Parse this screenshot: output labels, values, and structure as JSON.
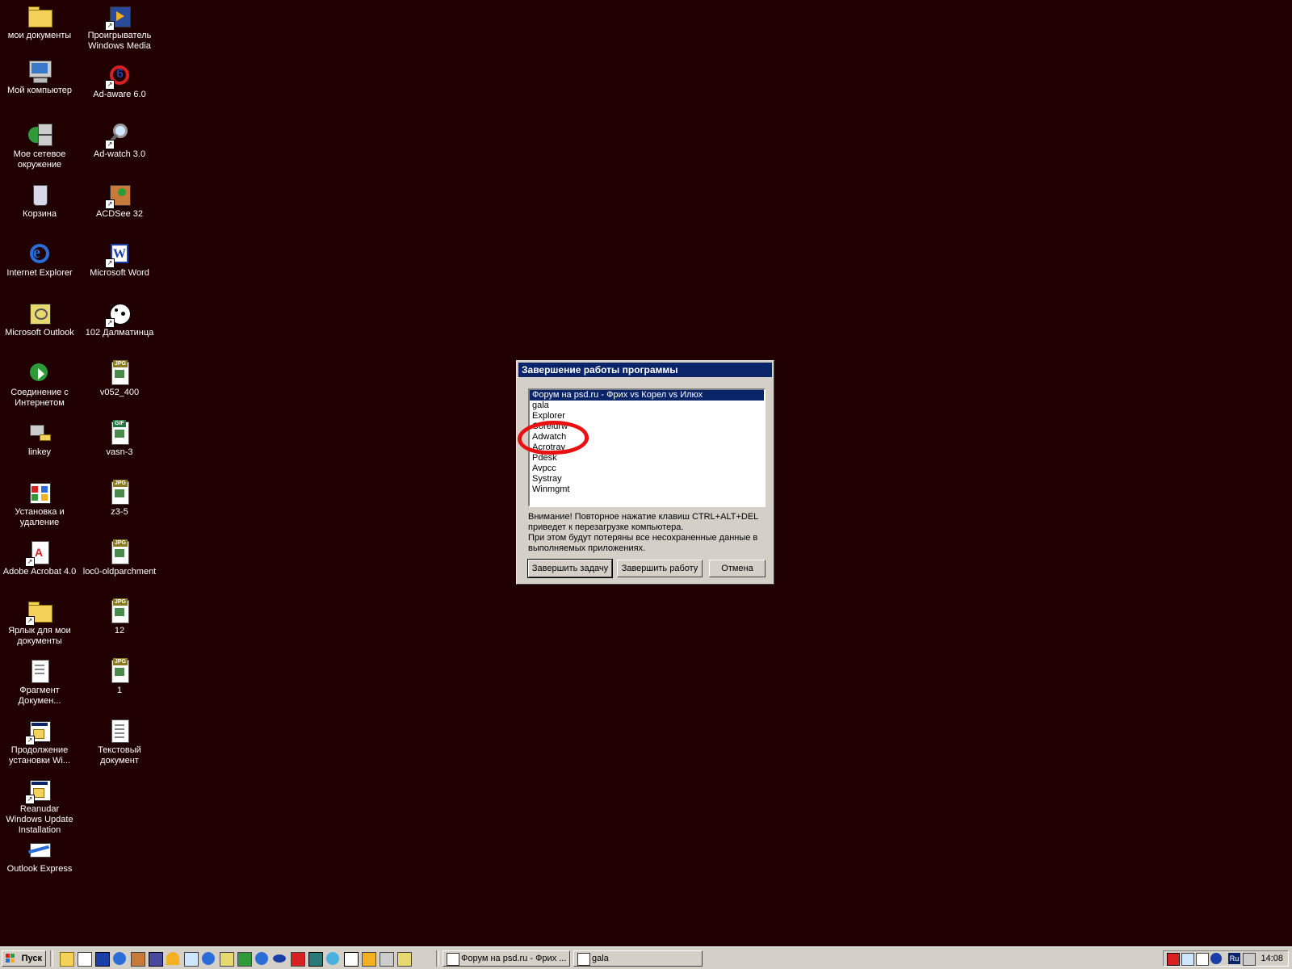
{
  "desktop": {
    "background": "#200000",
    "icons": [
      {
        "label": "мои документы",
        "icon": "folder-icon"
      },
      {
        "label": "Проигрыватель Windows Media",
        "icon": "media-player-icon"
      },
      {
        "label": "Мой компьютер",
        "icon": "computer-icon"
      },
      {
        "label": "Ad-aware 6.0",
        "icon": "adaware-icon"
      },
      {
        "label": "Мое сетевое окружение",
        "icon": "network-icon"
      },
      {
        "label": "Ad-watch 3.0",
        "icon": "adwatch-icon"
      },
      {
        "label": "Корзина",
        "icon": "recycle-bin-icon"
      },
      {
        "label": "ACDSee 32",
        "icon": "acdsee-icon"
      },
      {
        "label": "Internet Explorer",
        "icon": "internet-explorer-icon"
      },
      {
        "label": "Microsoft Word",
        "icon": "word-icon"
      },
      {
        "label": "Microsoft Outlook",
        "icon": "outlook-icon"
      },
      {
        "label": "102 Далматинца",
        "icon": "dalmatians-icon"
      },
      {
        "label": "Соединение с Интернетом",
        "icon": "internet-connection-icon"
      },
      {
        "label": "v052_400",
        "icon": "jpg-file-icon",
        "badge": "JPG"
      },
      {
        "label": "linkey",
        "icon": "linkey-icon"
      },
      {
        "label": "vasn-3",
        "icon": "gif-file-icon",
        "badge": "GIF"
      },
      {
        "label": "Установка и удаление",
        "icon": "add-remove-icon"
      },
      {
        "label": "z3-5",
        "icon": "jpg-file-icon",
        "badge": "JPG"
      },
      {
        "label": "Adobe Acrobat 4.0",
        "icon": "acrobat-icon"
      },
      {
        "label": "loc0-oldparchment",
        "icon": "jpg-file-icon",
        "badge": "JPG"
      },
      {
        "label": "Ярлык для мои документы",
        "icon": "folder-shortcut-icon"
      },
      {
        "label": "12",
        "icon": "jpg-file-icon",
        "badge": "JPG"
      },
      {
        "label": "Фрагмент Докумен...",
        "icon": "document-fragment-icon"
      },
      {
        "label": "1",
        "icon": "jpg-file-icon",
        "badge": "JPG"
      },
      {
        "label": "Продолжение установки Wi...",
        "icon": "setup-icon"
      },
      {
        "label": "Текстовый документ",
        "icon": "text-document-icon"
      },
      {
        "label": "Reanudar Windows Update Installation",
        "icon": "setup-icon"
      },
      {
        "label": "Outlook Express",
        "icon": "outlook-express-icon"
      }
    ]
  },
  "dialog": {
    "title": "Завершение работы программы",
    "list": [
      "Форум на psd.ru - Фрих vs Корел vs Илюх",
      "gala",
      "Explorer",
      "Coreldrw",
      "Adwatch",
      "Acrotray",
      "Pdesk",
      "Avpcc",
      "Systray",
      "Winmgmt"
    ],
    "selected_index": 0,
    "message_line1": "Внимание! Повторное нажатие клавиш CTRL+ALT+DEL",
    "message_line2": "приведет к перезагрузке компьютера.",
    "message_line3": "При этом будут потеряны все несохраненные данные в",
    "message_line4": "выполняемых приложениях.",
    "buttons": {
      "end_task": "Завершить задачу",
      "shutdown": "Завершить работу",
      "cancel": "Отмена"
    },
    "annotation_color": "#e81010"
  },
  "taskbar": {
    "start_label": "Пуск",
    "tasks": [
      {
        "label": "Форум на psd.ru - Фрих ...",
        "icon": "browser-window-icon"
      },
      {
        "label": "gala",
        "icon": "browser-window-icon"
      }
    ],
    "tray": {
      "language": "Ru",
      "clock": "14:08"
    }
  },
  "colors": {
    "titlebar": "#0a246a",
    "face": "#d4d0c8"
  }
}
